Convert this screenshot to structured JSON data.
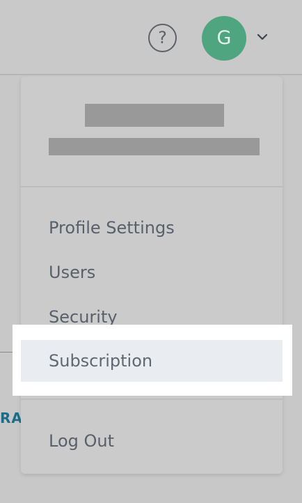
{
  "header": {
    "help_icon_glyph": "?",
    "avatar_initial": "G",
    "avatar_color": "#4fa57f"
  },
  "background": {
    "partial_link_text": "RA"
  },
  "menu": {
    "items": [
      {
        "label": "Profile Settings"
      },
      {
        "label": "Users"
      },
      {
        "label": "Security"
      },
      {
        "label": "Subscription",
        "highlighted": true
      },
      {
        "label": "Log Out"
      }
    ]
  },
  "colors": {
    "highlight": "#e9ecf1",
    "text": "#58606a",
    "link": "#1a6e8a"
  },
  "icons": [
    "help-icon",
    "chevron-down-icon"
  ]
}
